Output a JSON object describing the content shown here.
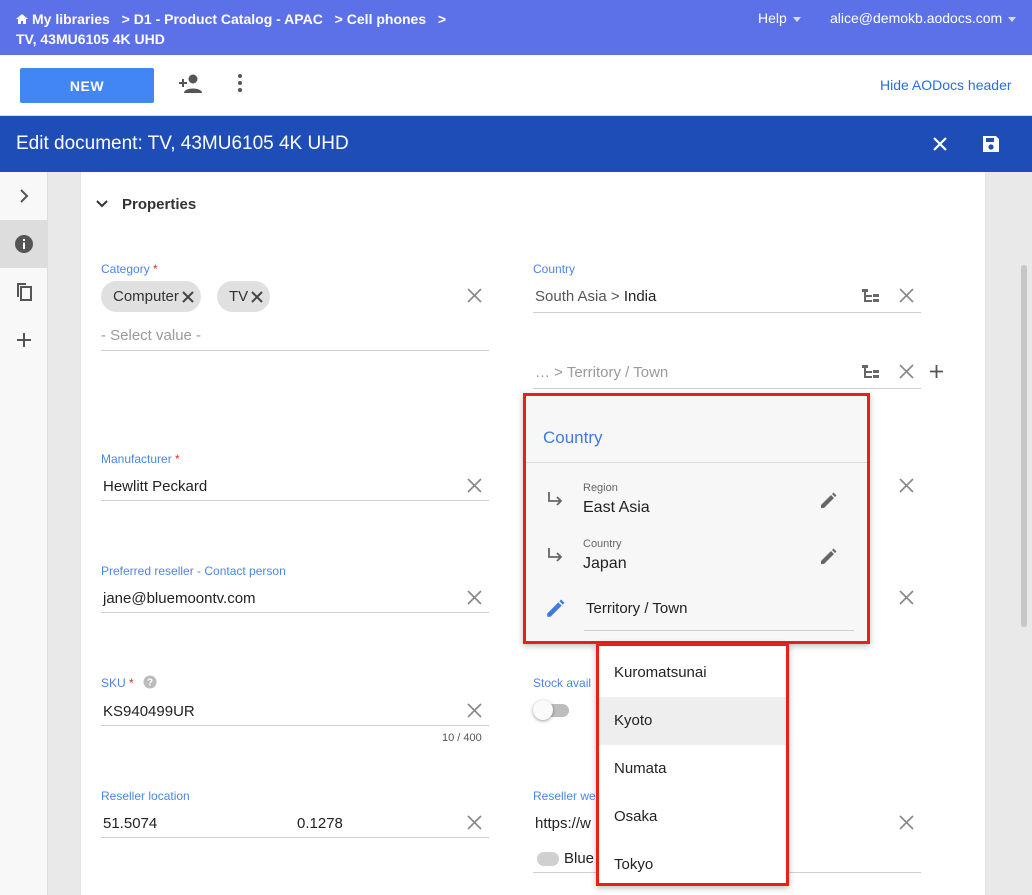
{
  "breadcrumb": {
    "items": [
      "My libraries",
      "D1 - Product Catalog - APAC",
      "Cell phones"
    ],
    "current": "TV, 43MU6105 4K UHD"
  },
  "topbar": {
    "help": "Help",
    "user": "alice@demokb.aodocs.com"
  },
  "toolbar": {
    "new_label": "NEW",
    "hide_header": "Hide AODocs header"
  },
  "editbar": {
    "title": "Edit document: TV, 43MU6105 4K UHD"
  },
  "section": {
    "title": "Properties"
  },
  "fields": {
    "category": {
      "label": "Category",
      "required": "*",
      "chips": [
        "Computer",
        "TV"
      ],
      "placeholder": "- Select value -"
    },
    "country": {
      "label": "Country",
      "path": "South Asia >",
      "value": "India",
      "second_placeholder": "… > Territory / Town"
    },
    "manufacturer": {
      "label": "Manufacturer",
      "required": "*",
      "value": "Hewlitt Peckard"
    },
    "reseller_contact": {
      "label": "Preferred reseller - Contact person",
      "value": "jane@bluemoontv.com"
    },
    "sku": {
      "label": "SKU",
      "required": "*",
      "value": "KS940499UR",
      "counter": "10 / 400"
    },
    "stock": {
      "label": "Stock avail"
    },
    "reseller_location": {
      "label": "Reseller location",
      "lat": "51.5074",
      "lng": "0.1278"
    },
    "reseller_web": {
      "label": "Reseller we",
      "value": "https://w",
      "chip_text": "Blue"
    }
  },
  "country_popup": {
    "title": "Country",
    "region_label": "Region",
    "region_value": "East Asia",
    "country_label": "Country",
    "country_value": "Japan",
    "territory_placeholder": "Territory / Town"
  },
  "dropdown": {
    "options": [
      "Kuromatsunai",
      "Kyoto",
      "Numata",
      "Osaka",
      "Tokyo"
    ],
    "highlighted": "Kyoto"
  },
  "colors": {
    "topbar": "#5c70e8",
    "editbar": "#1e4db7",
    "accent": "#4285f4",
    "highlight_border": "#e82017"
  }
}
